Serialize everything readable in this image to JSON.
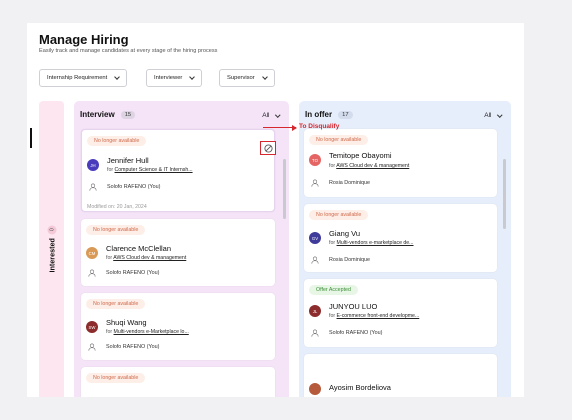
{
  "header": {
    "title": "Manage Hiring",
    "subtitle": "Easily track and manage candidates at every stage of the hiring process"
  },
  "filters": {
    "internship": "Internship Requirement",
    "interviewer": "Interviewer",
    "supervisor": "Supervisor"
  },
  "interested": {
    "label": "Interested",
    "count": "0"
  },
  "interview": {
    "name": "Interview",
    "count": "15",
    "filter": "All",
    "cards": [
      {
        "badge": "No longer available",
        "initials": "JH",
        "name": "Jennifer Hull",
        "for_prefix": "for",
        "role": "Computer Science & IT Internsh...",
        "owner": "Solofo RAFENO (You)",
        "modified": "Modified on: 20 Jan, 2024"
      },
      {
        "badge": "No longer available",
        "initials": "CM",
        "name": "Clarence McClellan",
        "for_prefix": "for",
        "role": "AWS Cloud dev & management",
        "owner": "Solofo RAFENO (You)"
      },
      {
        "badge": "No longer available",
        "initials": "SW",
        "name": "Shuqi Wang",
        "for_prefix": "for",
        "role": "Multi-vendors e-Marketplace lo...",
        "owner": "Solofo RAFENO (You)"
      },
      {
        "badge": "No longer available"
      }
    ]
  },
  "offer": {
    "name": "In offer",
    "count": "17",
    "filter": "All",
    "cards": [
      {
        "badge": "No longer available",
        "initials": "TO",
        "name": "Temitope Obayomi",
        "for_prefix": "for",
        "role": "AWS Cloud dev & management",
        "owner": "Rosia Dominique"
      },
      {
        "badge": "No longer available",
        "initials": "GV",
        "name": "Giang Vu",
        "for_prefix": "for",
        "role": "Multi-vendors e-marketplace de...",
        "owner": "Rosia Dominique"
      },
      {
        "badge": "Offer Accepted",
        "initials": "JL",
        "name": "JUNYOU LUO",
        "for_prefix": "for",
        "role": "E-commerce front-end developme...",
        "owner": "Solofo RAFENO (You)"
      },
      {
        "name": "Ayosim Bordeliova"
      }
    ]
  },
  "annotation": {
    "label": "To Disqualify"
  },
  "colors": {
    "accent_red": "#d6262e",
    "badge_text": "#d16a4a",
    "offer_green": "#3b8f37",
    "interview_bg": "#f5e3f7",
    "offer_bg": "#e7eefb",
    "interested_bg": "#fde6ef"
  },
  "icons": {
    "disqualify": "ban-circle-icon",
    "owner": "user-icon",
    "dropdown": "chevron-down-icon"
  }
}
